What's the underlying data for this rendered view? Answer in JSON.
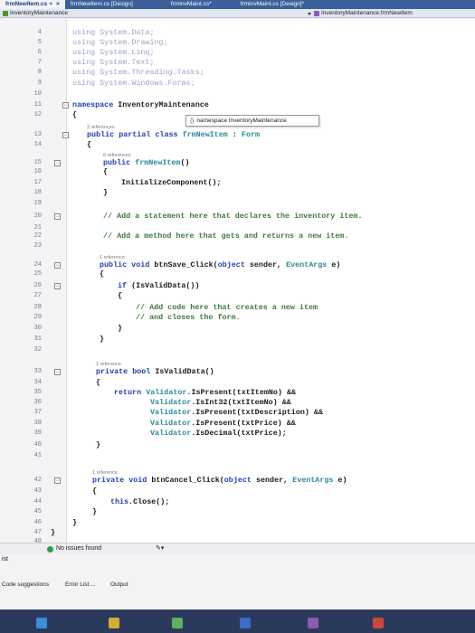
{
  "tabs": [
    {
      "label": "frmNewItem.cs",
      "modified": "+",
      "close": "×",
      "active": true
    },
    {
      "label": "frmNewItem.cs [Design]",
      "active": false
    },
    {
      "label": "frmInvMaint.cs*",
      "active": false
    },
    {
      "label": "frmInvMaint.cs [Design]*",
      "active": false
    }
  ],
  "navbar": {
    "project": "InventoryMaintenance",
    "member": "InventoryMaintenance.frmNewItem"
  },
  "tooltip": {
    "icon": "{}",
    "text": "namespace InventoryMaintenance"
  },
  "code_lines": [
    {
      "n": "4",
      "text": "using System.Data;"
    },
    {
      "n": "5",
      "text": "using System.Drawing;"
    },
    {
      "n": "6",
      "text": "using System.Linq;"
    },
    {
      "n": "7",
      "text": "using System.Text;"
    },
    {
      "n": "8",
      "text": "using System.Threading.Tasks;"
    },
    {
      "n": "9",
      "text": "using System.Windows.Forms;"
    },
    {
      "n": "10",
      "text": ""
    },
    {
      "n": "11",
      "text": "namespace InventoryMaintenance"
    },
    {
      "n": "12",
      "text": "{"
    },
    {
      "n": "13",
      "ref": "2 references",
      "text": "public partial class frmNewItem : Form"
    },
    {
      "n": "14",
      "text": "{"
    },
    {
      "n": "15",
      "ref": "0 references",
      "text": "public frmNewItem()"
    },
    {
      "n": "16",
      "text": "{"
    },
    {
      "n": "17",
      "text": "InitializeComponent();"
    },
    {
      "n": "18",
      "text": "}"
    },
    {
      "n": "19",
      "text": ""
    },
    {
      "n": "20",
      "text": "// Add a statement here that declares the inventory item."
    },
    {
      "n": "21",
      "text": ""
    },
    {
      "n": "22",
      "text": "// Add a method here that gets and returns a new item."
    },
    {
      "n": "23",
      "text": ""
    },
    {
      "n": "24",
      "ref": "1 reference",
      "text": "public void btnSave_Click(object sender, EventArgs e)"
    },
    {
      "n": "25",
      "text": "{"
    },
    {
      "n": "26",
      "text": "if (IsValidData())"
    },
    {
      "n": "27",
      "text": "{"
    },
    {
      "n": "28",
      "text": "// Add code here that creates a new item"
    },
    {
      "n": "29",
      "text": "// and closes the form."
    },
    {
      "n": "30",
      "text": "}"
    },
    {
      "n": "31",
      "text": "}"
    },
    {
      "n": "32",
      "text": ""
    },
    {
      "n": "33",
      "ref": "1 reference",
      "text": "private bool IsValidData()"
    },
    {
      "n": "34",
      "text": "{"
    },
    {
      "n": "35",
      "text": "return Validator.IsPresent(txtItemNo) &&"
    },
    {
      "n": "36",
      "text": "Validator.IsInt32(txtItemNo) &&"
    },
    {
      "n": "37",
      "text": "Validator.IsPresent(txtDescription) &&"
    },
    {
      "n": "38",
      "text": "Validator.IsPresent(txtPrice) &&"
    },
    {
      "n": "39",
      "text": "Validator.IsDecimal(txtPrice);"
    },
    {
      "n": "40",
      "text": "}"
    },
    {
      "n": "41",
      "text": ""
    },
    {
      "n": "42",
      "ref": "1 reference",
      "text": "private void btnCancel_Click(object sender, EventArgs e)"
    },
    {
      "n": "43",
      "text": "{"
    },
    {
      "n": "44",
      "text": "this.Close();"
    },
    {
      "n": "45",
      "text": "}"
    },
    {
      "n": "46",
      "text": "}"
    },
    {
      "n": "47",
      "text": "}"
    },
    {
      "n": "48",
      "text": ""
    }
  ],
  "status": {
    "issues": "No issues found",
    "pane_label": "ist"
  },
  "panel_tabs": [
    "Code suggestions",
    "Error List ...",
    "Output"
  ]
}
